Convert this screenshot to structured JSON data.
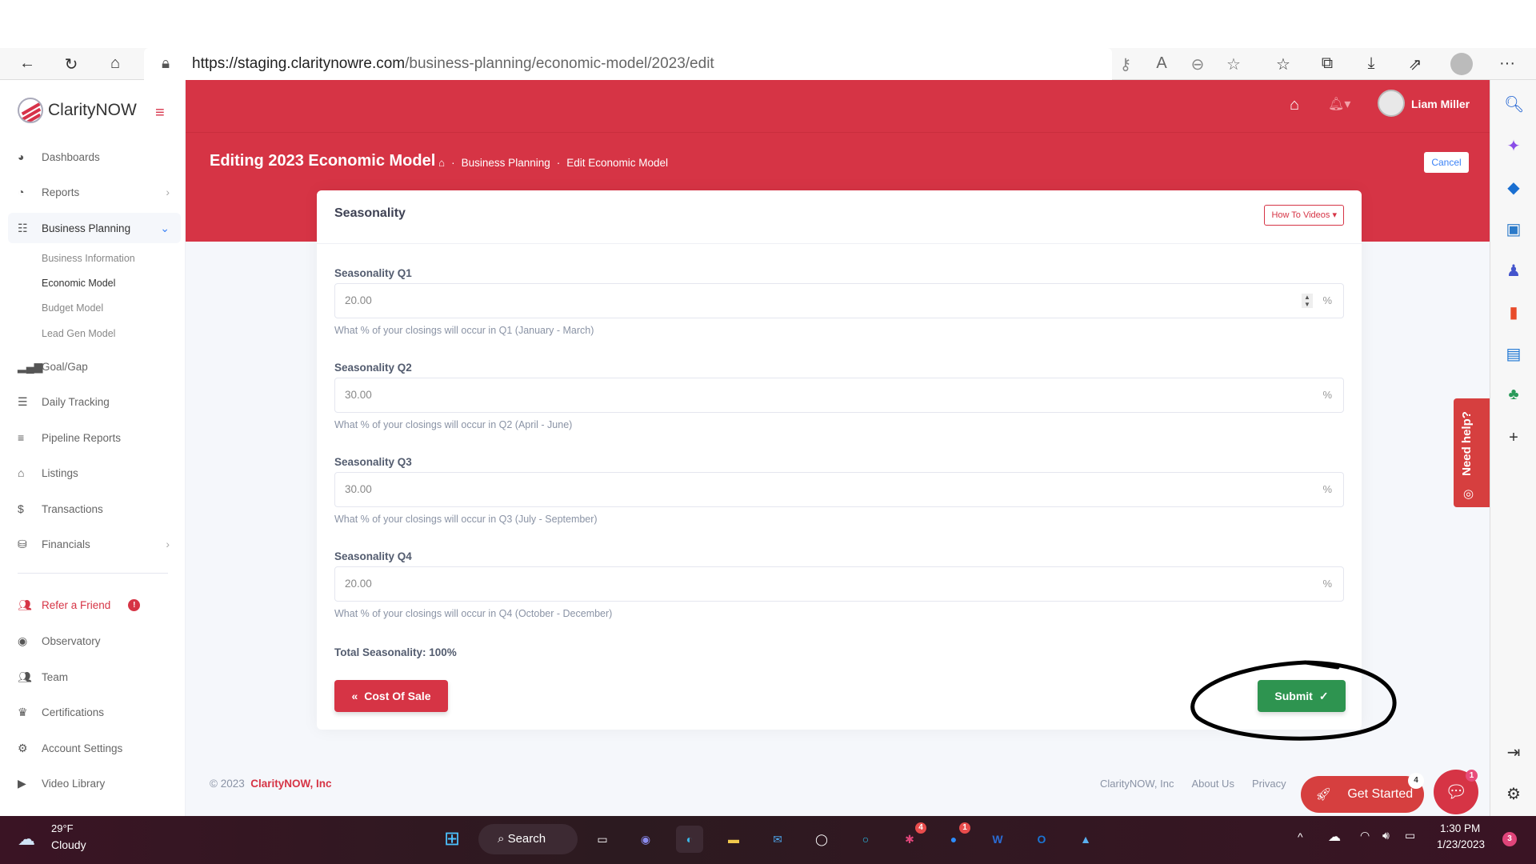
{
  "browser": {
    "url_domain": "https://staging.claritynowre.com",
    "url_path": "/business-planning/economic-model/2023/edit",
    "more": "···"
  },
  "sidebar": {
    "brand": "ClarityNOW",
    "items": [
      {
        "label": "Dashboards"
      },
      {
        "label": "Reports"
      },
      {
        "label": "Business Planning"
      },
      {
        "label": "Goal/Gap"
      },
      {
        "label": "Daily Tracking"
      },
      {
        "label": "Pipeline Reports"
      },
      {
        "label": "Listings"
      },
      {
        "label": "Transactions"
      },
      {
        "label": "Financials"
      },
      {
        "label": "Refer a Friend"
      },
      {
        "label": "Observatory"
      },
      {
        "label": "Team"
      },
      {
        "label": "Certifications"
      },
      {
        "label": "Account Settings"
      },
      {
        "label": "Video Library"
      }
    ],
    "sub_items": [
      {
        "label": "Business Information"
      },
      {
        "label": "Economic Model"
      },
      {
        "label": "Budget Model"
      },
      {
        "label": "Lead Gen Model"
      }
    ],
    "refer_badge": "!"
  },
  "header": {
    "user": "Liam Miller",
    "title": "Editing 2023 Economic Model",
    "breadcrumb": [
      "Business Planning",
      "Edit Economic Model"
    ],
    "cancel": "Cancel"
  },
  "card": {
    "title": "Seasonality",
    "videos": "How To Videos",
    "fields": [
      {
        "label": "Seasonality Q1",
        "value": "20.00",
        "help": "What % of your closings will occur in Q1 (January - March)"
      },
      {
        "label": "Seasonality Q2",
        "value": "30.00",
        "help": "What % of your closings will occur in Q2 (April - June)"
      },
      {
        "label": "Seasonality Q3",
        "value": "30.00",
        "help": "What % of your closings will occur in Q3 (July - September)"
      },
      {
        "label": "Seasonality Q4",
        "value": "20.00",
        "help": "What % of your closings will occur in Q4 (October - December)"
      }
    ],
    "unit": "%",
    "total": "Total Seasonality: 100%",
    "back": "Cost Of Sale",
    "submit": "Submit"
  },
  "footer": {
    "copy": "© 2023",
    "company": "ClarityNOW, Inc",
    "links": [
      "ClarityNOW, Inc",
      "About Us",
      "Privacy"
    ],
    "get_started": "Get Started",
    "get_started_badge": "4",
    "chat_badge": "1"
  },
  "help_tab": "Need help?",
  "taskbar": {
    "temp": "29°F",
    "weather": "Cloudy",
    "search": "Search",
    "time": "1:30 PM",
    "date": "1/23/2023",
    "slack_badge": "4",
    "zoom_badge": "1",
    "notif": "3"
  },
  "colors": {
    "brand": "#d63445",
    "submit": "#2e9450",
    "annotation": "#000000"
  }
}
